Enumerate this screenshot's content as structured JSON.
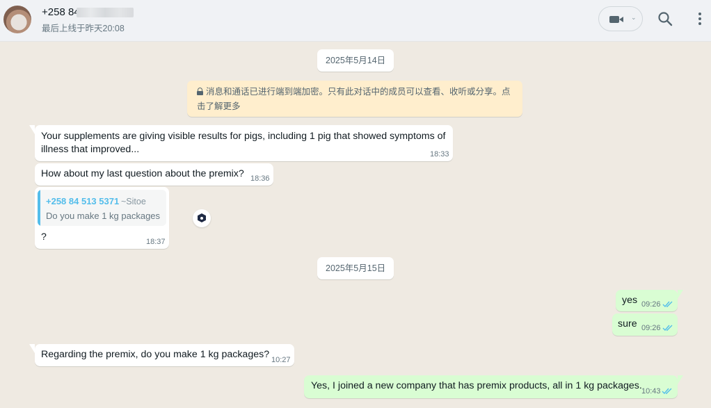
{
  "header": {
    "contact_name": "+258 84",
    "last_seen": "最后上线于昨天20:08",
    "video_dropdown_glyph": "⌄"
  },
  "chat": {
    "date1": "2025年5月14日",
    "encryption_notice": "消息和通话已进行端到端加密。只有此对话中的成员可以查看、收听或分享。点击了解更多",
    "date2": "2025年5月15日",
    "messages": [
      {
        "direction": "in",
        "text": "Your supplements are giving visible results for pigs, including 1 pig that showed symptoms of illness that improved...",
        "time": "18:33"
      },
      {
        "direction": "in",
        "text": "How about my last question about the premix?",
        "time": "18:36"
      },
      {
        "direction": "in",
        "quote": {
          "author": "+258 84 513 5371",
          "alias": "~Sitoe",
          "text": "Do you make 1 kg packages"
        },
        "text": "?",
        "time": "18:37"
      },
      {
        "direction": "out",
        "text": "yes",
        "time": "09:26",
        "status": "read"
      },
      {
        "direction": "out",
        "text": "sure",
        "time": "09:26",
        "status": "read"
      },
      {
        "direction": "in",
        "text": "Regarding the premix, do you make 1 kg packages?",
        "time": "10:27"
      },
      {
        "direction": "out",
        "text": "Yes, I joined a new company that has premix products, all in 1 kg packages.",
        "time": "10:43",
        "status": "read"
      }
    ]
  },
  "colors": {
    "outgoing_bubble": "#d9fdd3",
    "incoming_bubble": "#ffffff",
    "read_ticks": "#53bdeb",
    "chat_background": "#efeae2",
    "notice_background": "#ffeecd"
  },
  "icons": [
    "video-call-icon",
    "search-icon",
    "menu-icon",
    "lock-icon",
    "double-check-icon",
    "forward-icon"
  ]
}
